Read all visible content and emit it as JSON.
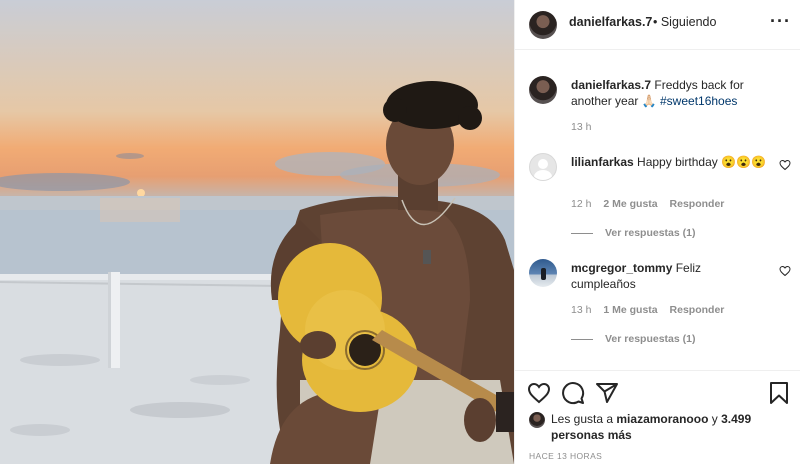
{
  "post": {
    "username": "danielfarkas.7",
    "follow_status": "• Siguiendo",
    "more_icon": "more-options-icon",
    "caption": {
      "username": "danielfarkas.7",
      "text": "Freddys back for another year 🙏🏻",
      "hashtag": "#sweet16hoes",
      "time": "13 h"
    },
    "comments": [
      {
        "username": "lilianfarkas",
        "text": "Happy birthday 😮😮😮",
        "time": "12 h",
        "likes": "2 Me gusta",
        "reply": "Responder",
        "view_replies": "Ver respuestas (1)"
      },
      {
        "username": "mcgregor_tommy",
        "text": "Feliz cumpleaños",
        "time": "13 h",
        "likes": "1 Me gusta",
        "reply": "Responder",
        "view_replies": "Ver respuestas (1)"
      }
    ],
    "likes_prefix": "Les gusta a",
    "likes_user": "miazamoranooo",
    "likes_and": "y",
    "likes_count": "3.499 personas más",
    "timestamp": "HACE 13 HORAS",
    "icons": [
      "heart-icon",
      "comment-icon",
      "share-icon",
      "bookmark-icon"
    ]
  }
}
